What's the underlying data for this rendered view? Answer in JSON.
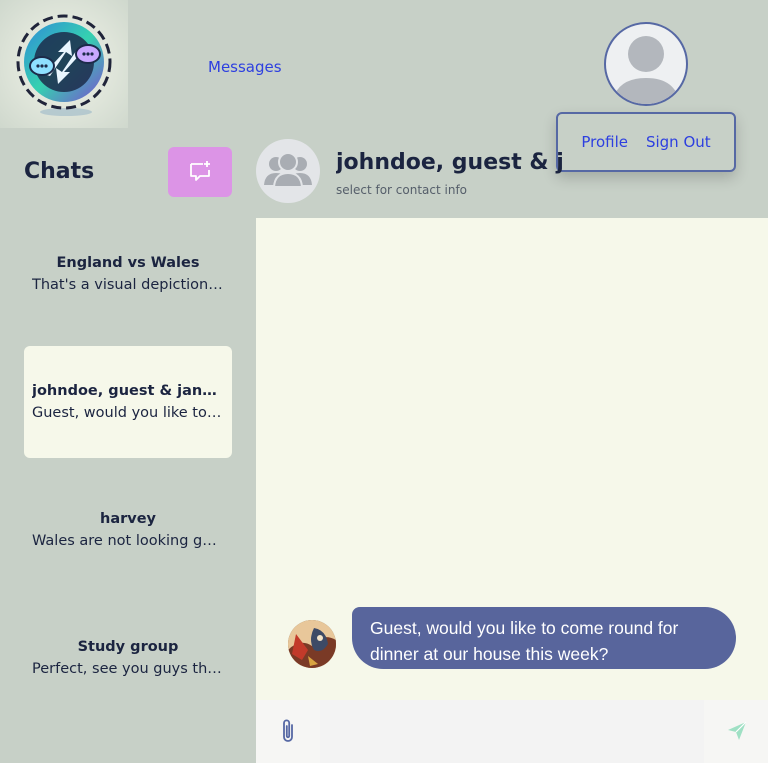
{
  "header": {
    "nav_link": "Messages",
    "menu": {
      "profile": "Profile",
      "sign_out": "Sign Out"
    }
  },
  "sidebar": {
    "title": "Chats",
    "new_chat_icon": "new-message-icon",
    "chats": [
      {
        "name": "England vs Wales",
        "preview": "That's a visual depiction ...",
        "active": false
      },
      {
        "name": "johndoe, guest & janed...",
        "preview": "Guest, would you like to ...",
        "active": true
      },
      {
        "name": "harvey",
        "preview": "Wales are not looking go...",
        "active": false
      },
      {
        "name": "Study group",
        "preview": "Perfect, see you guys then!",
        "active": false
      }
    ]
  },
  "conversation": {
    "title": "johndoe, guest & janedoe",
    "subtitle": "select for contact info",
    "messages": [
      {
        "text": "Guest, would you like to come round for dinner at our house this week?"
      }
    ]
  },
  "composer": {
    "attach_icon": "paperclip-icon",
    "input_value": "",
    "send_icon": "send-icon"
  },
  "colors": {
    "sidebar_bg": "#c7d0c7",
    "chat_bg": "#f6f8ea",
    "accent": "#dc94e6",
    "bubble": "#58659c",
    "link": "#2d3fe0"
  }
}
